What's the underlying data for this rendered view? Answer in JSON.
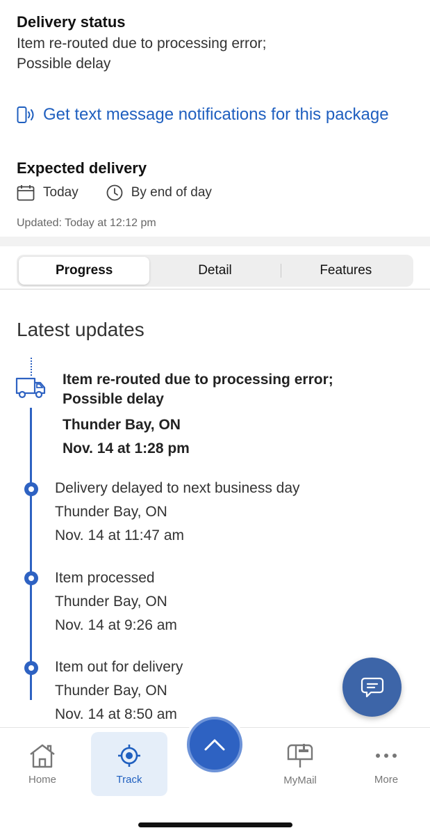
{
  "delivery_status": {
    "title": "Delivery status",
    "line1": "Item re-routed due to processing error;",
    "line2": "Possible delay"
  },
  "notification_link": "Get text message notifications for this package",
  "expected_delivery": {
    "title": "Expected delivery",
    "date": "Today",
    "time": "By end of day",
    "updated": "Updated: Today at 12:12 pm"
  },
  "tabs": [
    {
      "label": "Progress",
      "active": true
    },
    {
      "label": "Detail",
      "active": false
    },
    {
      "label": "Features",
      "active": false
    }
  ],
  "latest_updates": {
    "title": "Latest updates",
    "current": {
      "line1": "Item re-routed due to processing error;",
      "line2": "Possible delay",
      "location": "Thunder Bay, ON",
      "time": "Nov. 14 at 1:28 pm"
    },
    "events": [
      {
        "status": "Delivery delayed to next business day",
        "location": "Thunder Bay, ON",
        "time": "Nov. 14 at 11:47 am"
      },
      {
        "status": "Item processed",
        "location": "Thunder Bay, ON",
        "time": "Nov. 14 at 9:26 am"
      },
      {
        "status": "Item out for delivery",
        "location": "Thunder Bay, ON",
        "time": "Nov. 14 at 8:50 am"
      }
    ]
  },
  "bottom_nav": {
    "items": [
      {
        "label": "Home",
        "icon": "home-icon"
      },
      {
        "label": "Track",
        "icon": "target-icon",
        "active": true
      },
      {
        "label": "MyMail",
        "icon": "mailbox-icon"
      },
      {
        "label": "More",
        "icon": "more-icon"
      }
    ]
  },
  "colors": {
    "accent": "#1f5fbf",
    "timeline": "#2e62c2",
    "chat_fab": "#3d65a8"
  }
}
